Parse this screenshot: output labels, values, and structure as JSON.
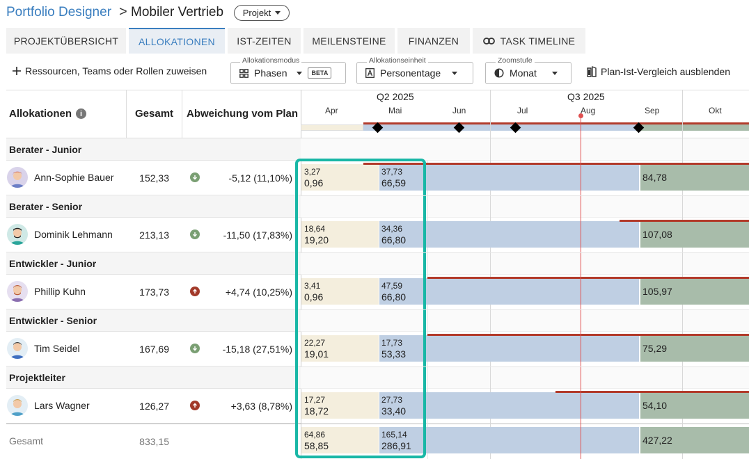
{
  "header": {
    "breadcrumb": "Portfolio Designer",
    "separator": ">",
    "title": "Mobiler Vertrieb",
    "badge": "Projekt"
  },
  "tabs": [
    {
      "label": "PROJEKTÜBERSICHT",
      "active": false
    },
    {
      "label": "ALLOKATIONEN",
      "active": true
    },
    {
      "label": "IST-ZEITEN",
      "active": false
    },
    {
      "label": "MEILENSTEINE",
      "active": false
    },
    {
      "label": "FINANZEN",
      "active": false
    },
    {
      "label": "TASK TIMELINE",
      "active": false,
      "icon": "link-icon"
    }
  ],
  "toolbar": {
    "assign_label": "Ressourcen, Teams oder Rollen zuweisen",
    "mode_label": "Allokationsmodus",
    "mode_value": "Phasen",
    "mode_badge": "BETA",
    "unit_label": "Allokationseinheit",
    "unit_value": "Personentage",
    "zoom_label": "Zoomstufe",
    "zoom_value": "Monat",
    "compare_label": "Plan-Ist-Vergleich ausblenden"
  },
  "columns": {
    "allocations": "Allokationen",
    "total": "Gesamt",
    "deviation": "Abweichung vom Plan"
  },
  "timeline": {
    "quarters": [
      "Q2 2025",
      "Q3 2025"
    ],
    "months": [
      "Apr",
      "Mai",
      "Jun",
      "Jul",
      "Aug",
      "Sep",
      "Okt"
    ]
  },
  "groups": [
    {
      "label": "Berater - Junior",
      "person": {
        "name": "Ann-Sophie Bauer",
        "total": "152,33",
        "direction": "down",
        "deviation": "-5,12 (11,10%)",
        "c1_top": "3,27",
        "c1_bottom": "0,96",
        "c2_top": "37,73",
        "c2_bottom": "66,59",
        "c3": "84,78"
      }
    },
    {
      "label": "Berater - Senior",
      "person": {
        "name": "Dominik Lehmann",
        "total": "213,13",
        "direction": "down",
        "deviation": "-11,50 (17,83%)",
        "c1_top": "18,64",
        "c1_bottom": "19,20",
        "c2_top": "34,36",
        "c2_bottom": "66,80",
        "c3": "107,08"
      }
    },
    {
      "label": "Entwickler - Junior",
      "person": {
        "name": "Phillip Kuhn",
        "total": "173,73",
        "direction": "up",
        "deviation": "+4,74 (10,25%)",
        "c1_top": "3,41",
        "c1_bottom": "0,96",
        "c2_top": "47,59",
        "c2_bottom": "66,80",
        "c3": "105,97"
      }
    },
    {
      "label": "Entwickler - Senior",
      "person": {
        "name": "Tim Seidel",
        "total": "167,69",
        "direction": "down",
        "deviation": "-15,18 (27,51%)",
        "c1_top": "22,27",
        "c1_bottom": "19,01",
        "c2_top": "17,73",
        "c2_bottom": "53,33",
        "c3": "75,29"
      }
    },
    {
      "label": "Projektleiter",
      "person": {
        "name": "Lars Wagner",
        "total": "126,27",
        "direction": "up",
        "deviation": "+3,63 (8,78%)",
        "c1_top": "17,27",
        "c1_bottom": "18,72",
        "c2_top": "27,73",
        "c2_bottom": "33,40",
        "c3": "54,10"
      }
    }
  ],
  "footer": {
    "label": "Gesamt",
    "total": "833,15",
    "c1_top": "64,86",
    "c1_bottom": "58,85",
    "c2_top": "165,14",
    "c2_bottom": "286,91",
    "c3": "427,22"
  },
  "colors": {
    "accent": "#3a7ebf",
    "highlight": "#19b7a6",
    "today_line": "#e05050",
    "plan_line": "#b23a2a",
    "phase1": "#f4eedd",
    "phase2": "#bfcfe3",
    "phase3": "#a8bcaa"
  }
}
